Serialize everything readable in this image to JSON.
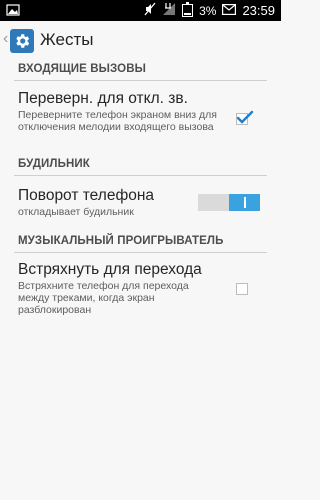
{
  "status_bar": {
    "battery_percent": "3%",
    "time": "23:59",
    "icons": [
      "image-icon",
      "mute-icon",
      "signal-icon",
      "battery-icon"
    ]
  },
  "action_bar": {
    "title": "Жесты",
    "icon": "settings-gear-icon"
  },
  "sections": [
    {
      "header": "ВХОДЯЩИЕ ВЫЗОВЫ",
      "items": [
        {
          "title": "Переверн. для откл. зв.",
          "summary": "Переверните телефон экраном вниз для отключения мелодии входящего вызова",
          "control": "checkbox",
          "checked": true
        }
      ]
    },
    {
      "header": "БУДИЛЬНИК",
      "items": [
        {
          "title": "Поворот телефона",
          "summary": "откладывает будильник",
          "control": "switch",
          "checked": true
        }
      ]
    },
    {
      "header": "МУЗЫКАЛЬНЫЙ ПРОИГРЫВАТЕЛЬ",
      "items": [
        {
          "title": "Встряхнуть для перехода",
          "summary": "Встряхните телефон для перехода между треками, когда экран разблокирован",
          "control": "checkbox",
          "checked": false
        }
      ]
    }
  ],
  "colors": {
    "accent": "#3aa3df",
    "check": "#1f7fcf",
    "icon_bg": "#2e79b9"
  }
}
